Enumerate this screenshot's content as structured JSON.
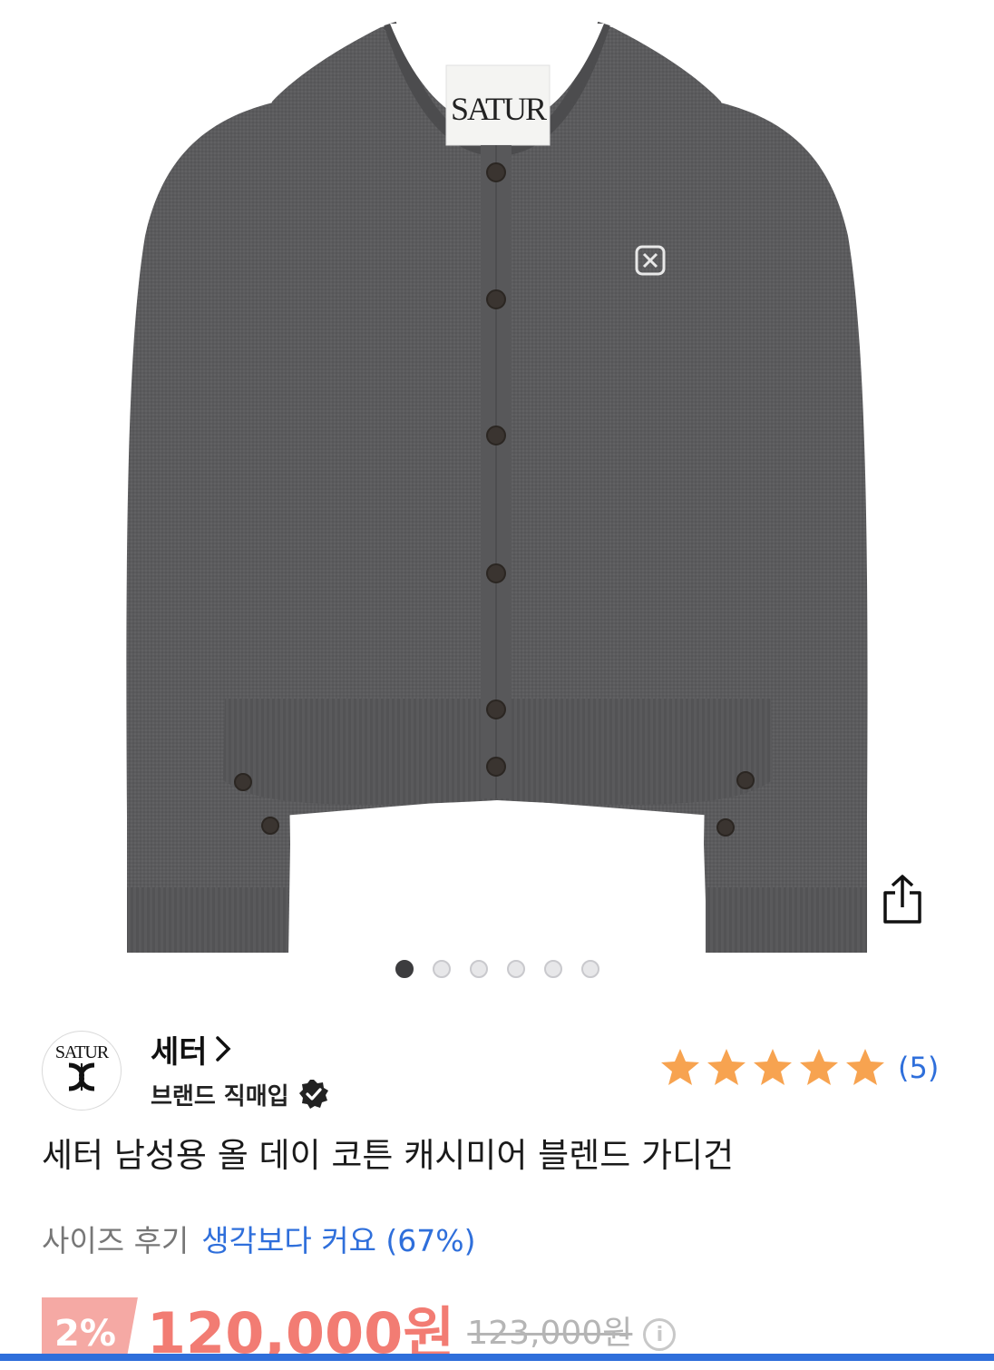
{
  "product": {
    "image_label": "SATUR",
    "image_alt": "Charcoal grey button cardigan"
  },
  "carousel": {
    "count": 6,
    "active": 0
  },
  "brand": {
    "logo_text": "SATUR",
    "name": "세터",
    "chevron": "›",
    "tag": "브랜드 직매입"
  },
  "rating": {
    "stars": 5,
    "count_label": "(5)",
    "star_color": "#f7a350"
  },
  "title": "세터 남성용 올 데이 코튼 캐시미어 블렌드 가디건",
  "size_review": {
    "label": "사이즈 후기",
    "value": "생각보다 커요 (67%)"
  },
  "price": {
    "discount": "2%",
    "sale": "120,000원",
    "original": "123,000원",
    "info": "i"
  },
  "colors": {
    "accent_blue": "#2f6fdb",
    "sale_red": "#f27c73",
    "discount_bg": "#f5a9a4",
    "sweater_grey": "#5a5a5c"
  }
}
